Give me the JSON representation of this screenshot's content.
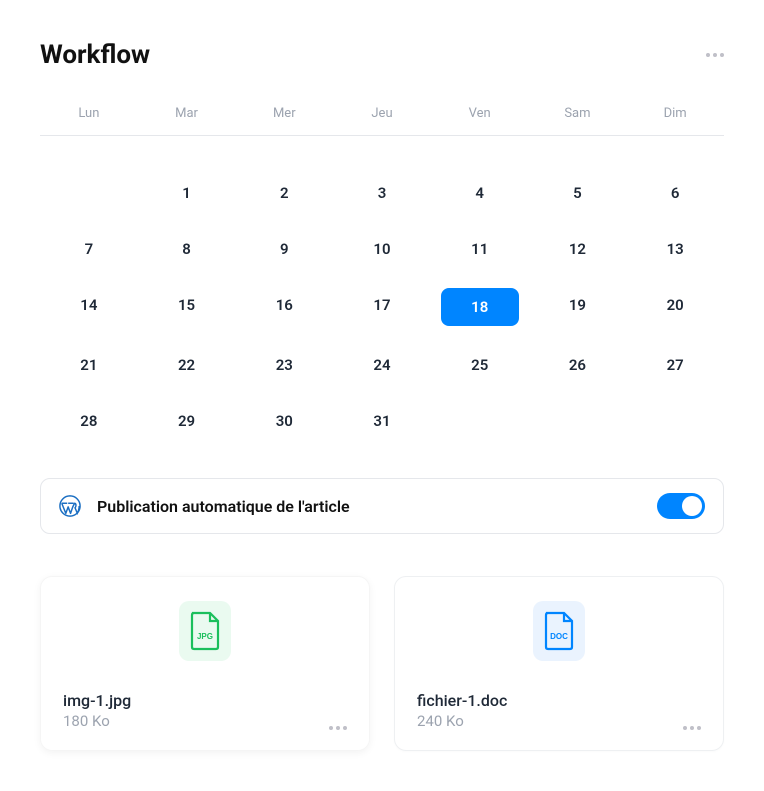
{
  "title": "Workflow",
  "calendar": {
    "weekdays": [
      "Lun",
      "Mar",
      "Mer",
      "Jeu",
      "Ven",
      "Sam",
      "Dim"
    ],
    "leadingEmpty": 1,
    "days": 31,
    "selected": 18
  },
  "setting": {
    "label": "Publication automatique de l'article",
    "enabled": true
  },
  "files": [
    {
      "name": "img-1.jpg",
      "size": "180 Ko",
      "type": "jpg",
      "typeLabel": "JPG",
      "color": "#1bbf5c"
    },
    {
      "name": "fichier-1.doc",
      "size": "240 Ko",
      "type": "doc",
      "typeLabel": "DOC",
      "color": "#0085ff"
    }
  ]
}
